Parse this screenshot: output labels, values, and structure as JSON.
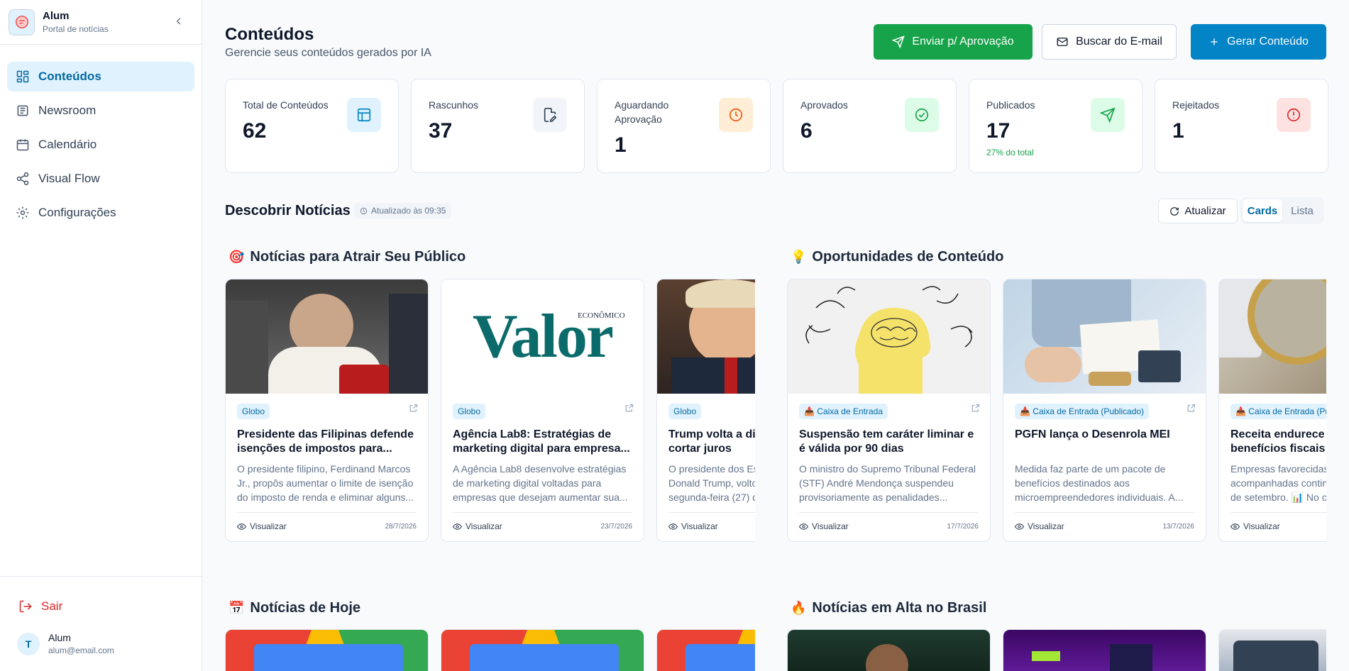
{
  "sidebar": {
    "brand_title": "Alum",
    "brand_subtitle": "Portal de notícias",
    "items": [
      {
        "label": "Conteúdos",
        "icon": "dashboard-icon",
        "active": true
      },
      {
        "label": "Newsroom",
        "icon": "newspaper-icon"
      },
      {
        "label": "Calendário",
        "icon": "calendar-icon"
      },
      {
        "label": "Visual Flow",
        "icon": "share-nodes-icon"
      },
      {
        "label": "Configurações",
        "icon": "gear-icon"
      }
    ],
    "logout_label": "Sair",
    "user": {
      "initial": "T",
      "name": "Alum",
      "email": "alum@email.com"
    }
  },
  "header": {
    "title": "Conteúdos",
    "subtitle": "Gerencie seus conteúdos gerados por IA",
    "send_label": "Enviar p/ Aprovação",
    "email_label": "Buscar do E-mail",
    "generate_label": "Gerar Conteúdo"
  },
  "stats": [
    {
      "label": "Total de Conteúdos",
      "value": "62",
      "icon": "layout-icon",
      "color": "#0284c7"
    },
    {
      "label": "Rascunhos",
      "value": "37",
      "icon": "file-edit-icon",
      "color": "#334155"
    },
    {
      "label": "Aguardando Aprovação",
      "value": "1",
      "icon": "clock-icon",
      "color": "#ea580c"
    },
    {
      "label": "Aprovados",
      "value": "6",
      "icon": "check-circle-icon",
      "color": "#16a34a"
    },
    {
      "label": "Publicados",
      "value": "17",
      "note": "27% do total",
      "icon": "send-icon",
      "color": "#16a34a"
    },
    {
      "label": "Rejeitados",
      "value": "1",
      "icon": "alert-circle-icon",
      "color": "#dc2626"
    }
  ],
  "discover": {
    "title": "Descobrir Notícias",
    "updated": "Atualizado às 09:35",
    "refresh_label": "Atualizar",
    "view_cards": "Cards",
    "view_list": "Lista"
  },
  "groups": [
    {
      "emoji": "🎯",
      "title": "Notícias para Atrair Seu Público",
      "cards": [
        {
          "source": "Globo",
          "title": "Presidente das Filipinas defende isenções de impostos para...",
          "desc": "O presidente filipino, Ferdinand Marcos Jr., propôs aumentar o limite de isenção do imposto de renda e eliminar alguns...",
          "date": "28/7/2026",
          "view": "Visualizar"
        },
        {
          "source": "Globo",
          "title": "Agência Lab8: Estratégias de marketing digital para empresa...",
          "desc": "A Agência Lab8 desenvolve estratégias de marketing digital voltadas para empresas que desejam aumentar sua...",
          "date": "23/7/2026",
          "view": "Visualizar",
          "logo_text": "Valor",
          "logo_small": "ECONÔMICO"
        },
        {
          "source": "Globo",
          "title": "Trump volta a dizer que deveria cortar juros",
          "desc": "O presidente dos Estados Unidos, Donald Trump, voltou a dizer nesta segunda-feira (27) que...",
          "date": "",
          "view": "Visualizar"
        }
      ]
    },
    {
      "emoji": "💡",
      "title": "Oportunidades de Conteúdo",
      "cards": [
        {
          "source": "Caixa de Entrada",
          "title": "Suspensão tem caráter liminar e é válida por 90 dias",
          "desc": "O ministro do Supremo Tribunal Federal (STF) André Mendonça suspendeu provisoriamente as penalidades...",
          "date": "17/7/2026",
          "view": "Visualizar"
        },
        {
          "source": "Caixa de Entrada (Publicado)",
          "title": "PGFN lança o Desenrola MEI",
          "desc": "Medida faz parte de um pacote de benefícios destinados aos microempreendedores individuais. A... Procuradoria-Geral da Fazenda Nacional",
          "date": "13/7/2026",
          "view": "Visualizar"
        },
        {
          "source": "Caixa de Entrada (Publicado)",
          "title": "Receita endurece fiscalização de benefícios fiscais",
          "desc": "Empresas favorecidas devem acompanhadas continuamente a partir de setembro. 📊 No c...",
          "date": "",
          "view": "Visualizar"
        }
      ]
    },
    {
      "emoji": "📅",
      "title": "Notícias de Hoje"
    },
    {
      "emoji": "🔥",
      "title": "Notícias em Alta no Brasil"
    }
  ]
}
